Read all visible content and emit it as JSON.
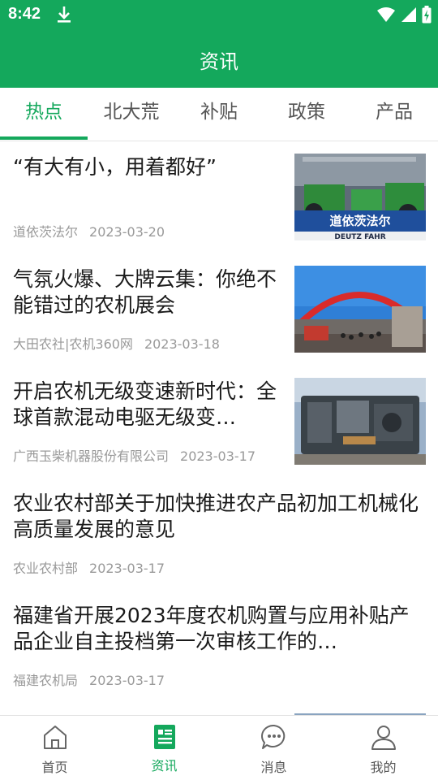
{
  "status_bar": {
    "time": "8:42"
  },
  "app_bar": {
    "title": "资讯"
  },
  "tabs": [
    {
      "label": "热点",
      "active": true
    },
    {
      "label": "北大荒",
      "active": false
    },
    {
      "label": "补贴",
      "active": false
    },
    {
      "label": "政策",
      "active": false
    },
    {
      "label": "产品",
      "active": false
    }
  ],
  "news": [
    {
      "title": "“有大有小，用着都好”",
      "source": "道依茨法尔",
      "date": "2023-03-20",
      "thumbnail": "tractor-expo-photo",
      "thumbnail_text": [
        "道依茨法尔",
        "DEUTZ FAHR"
      ]
    },
    {
      "title": "气氛火爆、大牌云集：你绝不能错过的农机展会",
      "source": "大田农社|农机360网",
      "date": "2023-03-18",
      "thumbnail": "expo-arch-photo"
    },
    {
      "title": "开启农机无级变速新时代：全球首款混动电驱无级变…",
      "source": "广西玉柴机器股份有限公司",
      "date": "2023-03-17",
      "thumbnail": "engine-photo"
    },
    {
      "title": "农业农村部关于加快推进农产品初加工机械化高质量发展的意见",
      "source": "农业农村部",
      "date": "2023-03-17"
    },
    {
      "title": "福建省开展2023年度农机购置与应用补贴产品企业自主投档第一次审核工作的…",
      "source": "福建农机局",
      "date": "2023-03-17"
    }
  ],
  "bottom_nav": [
    {
      "label": "首页",
      "icon": "home-icon",
      "active": false
    },
    {
      "label": "资讯",
      "icon": "news-icon",
      "active": true
    },
    {
      "label": "消息",
      "icon": "message-icon",
      "active": false
    },
    {
      "label": "我的",
      "icon": "profile-icon",
      "active": false
    }
  ],
  "colors": {
    "brand": "#14a85c",
    "text": "#1a1a1a",
    "meta": "#999999"
  }
}
